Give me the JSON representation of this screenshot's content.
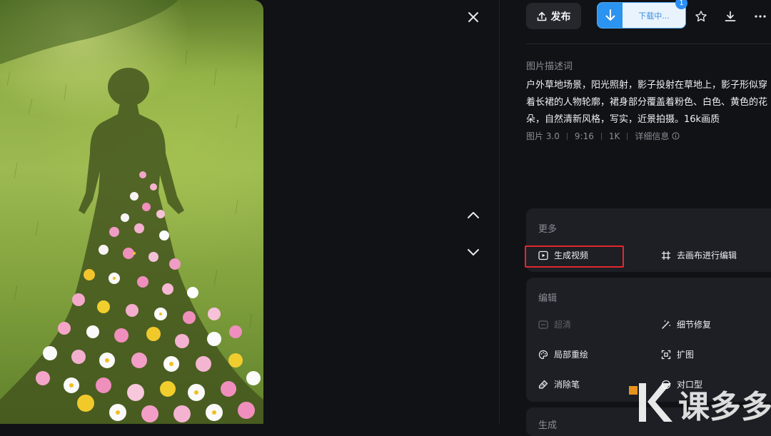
{
  "toolbar": {
    "publish_label": "发布",
    "download_status": "下载中...",
    "download_badge": "1",
    "icons": [
      "upload-icon",
      "download-arrow-icon",
      "star-icon",
      "download-icon",
      "more-icon"
    ]
  },
  "description": {
    "title": "图片描述词",
    "lines": [
      "户外草地场景，阳光照射，影子投射在草地上，影子形似穿",
      "着长裙的人物轮廓，裙身部分覆盖着粉色、白色、黄色的花",
      "朵，自然清新风格，写实，近景拍摄。16k画质"
    ],
    "meta": {
      "model": "图片 3.0",
      "ratio": "9:16",
      "resolution": "1K",
      "details": "详细信息"
    }
  },
  "more_card": {
    "title": "更多",
    "generate_video": "生成视频",
    "canvas_edit": "去画布进行编辑"
  },
  "edit_card": {
    "title": "编辑",
    "hd": "超清",
    "detail_fix": "细节修复",
    "local_redraw": "局部重绘",
    "expand": "扩图",
    "eraser": "消除笔",
    "partial": "对口型"
  },
  "next_card": {
    "title": "生成"
  },
  "watermark_text": "课多多",
  "colors": {
    "accent": "#2b93f0",
    "highlight": "#e2282c",
    "panel": "#1d1f24",
    "background": "#111216"
  }
}
